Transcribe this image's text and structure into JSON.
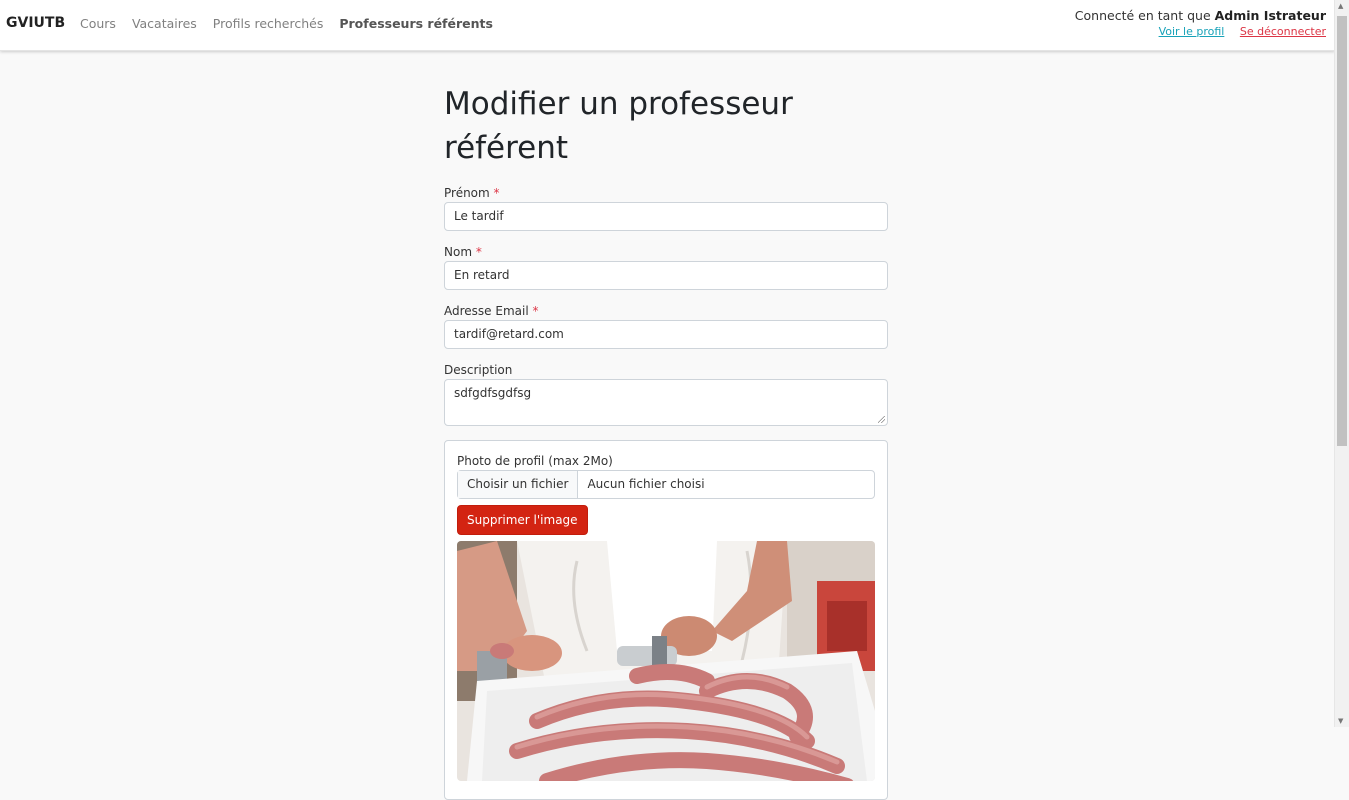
{
  "navbar": {
    "brand": "GVIUTB",
    "links": [
      "Cours",
      "Vacataires",
      "Profils recherchés",
      "Professeurs référents"
    ],
    "active": "Professeurs référents",
    "user_prefix": "Connecté en tant que",
    "user_name": "Admin Istrateur",
    "profile_link": "Voir le profil",
    "logout_link": "Se déconnecter"
  },
  "form": {
    "title": "Modifier un professeur référent",
    "required_marker": "*",
    "firstname": {
      "label": "Prénom",
      "value": "Le tardif"
    },
    "lastname": {
      "label": "Nom",
      "value": "En retard"
    },
    "email": {
      "label": "Adresse Email",
      "value": "tardif@retard.com"
    },
    "description": {
      "label": "Description",
      "value": "sdfgdfsgdfsg"
    },
    "photo": {
      "label": "Photo de profil (max 2Mo)",
      "choose_button": "Choisir un fichier",
      "no_file": "Aucun fichier choisi",
      "delete_button": "Supprimer l'image"
    }
  },
  "colors": {
    "danger": "#d32412",
    "link_info": "#17a2b8",
    "link_danger": "#dc3545"
  }
}
